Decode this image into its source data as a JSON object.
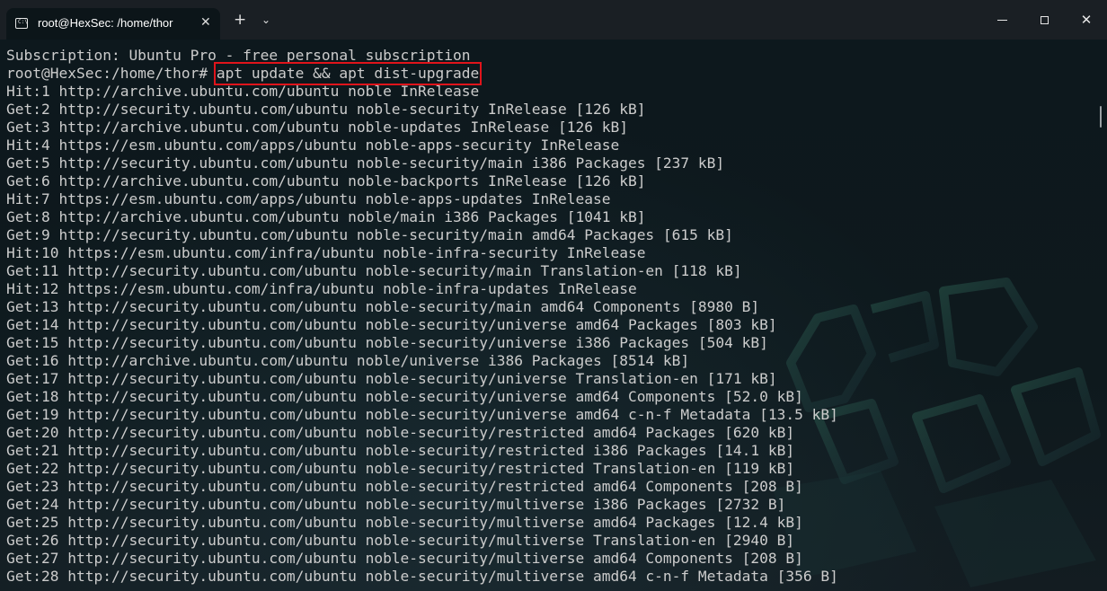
{
  "window": {
    "tab_title": "root@HexSec: /home/thor",
    "tab_icon": "terminal-icon",
    "tab_close": "✕",
    "new_tab": "+",
    "tab_dropdown": "⌄",
    "close_glyph": "✕"
  },
  "terminal": {
    "colors": {
      "text": "#cccccc",
      "highlight_box": "#e0141b",
      "background": "#0c1519"
    },
    "prompt": "root@HexSec:/home/thor# ",
    "command": "apt update && apt dist-upgrade",
    "lines": [
      "Subscription: Ubuntu Pro - free personal subscription",
      "Hit:1 http://archive.ubuntu.com/ubuntu noble InRelease",
      "Get:2 http://security.ubuntu.com/ubuntu noble-security InRelease [126 kB]",
      "Get:3 http://archive.ubuntu.com/ubuntu noble-updates InRelease [126 kB]",
      "Hit:4 https://esm.ubuntu.com/apps/ubuntu noble-apps-security InRelease",
      "Get:5 http://security.ubuntu.com/ubuntu noble-security/main i386 Packages [237 kB]",
      "Get:6 http://archive.ubuntu.com/ubuntu noble-backports InRelease [126 kB]",
      "Hit:7 https://esm.ubuntu.com/apps/ubuntu noble-apps-updates InRelease",
      "Get:8 http://archive.ubuntu.com/ubuntu noble/main i386 Packages [1041 kB]",
      "Get:9 http://security.ubuntu.com/ubuntu noble-security/main amd64 Packages [615 kB]",
      "Hit:10 https://esm.ubuntu.com/infra/ubuntu noble-infra-security InRelease",
      "Get:11 http://security.ubuntu.com/ubuntu noble-security/main Translation-en [118 kB]",
      "Hit:12 https://esm.ubuntu.com/infra/ubuntu noble-infra-updates InRelease",
      "Get:13 http://security.ubuntu.com/ubuntu noble-security/main amd64 Components [8980 B]",
      "Get:14 http://security.ubuntu.com/ubuntu noble-security/universe amd64 Packages [803 kB]",
      "Get:15 http://security.ubuntu.com/ubuntu noble-security/universe i386 Packages [504 kB]",
      "Get:16 http://archive.ubuntu.com/ubuntu noble/universe i386 Packages [8514 kB]",
      "Get:17 http://security.ubuntu.com/ubuntu noble-security/universe Translation-en [171 kB]",
      "Get:18 http://security.ubuntu.com/ubuntu noble-security/universe amd64 Components [52.0 kB]",
      "Get:19 http://security.ubuntu.com/ubuntu noble-security/universe amd64 c-n-f Metadata [13.5 kB]",
      "Get:20 http://security.ubuntu.com/ubuntu noble-security/restricted amd64 Packages [620 kB]",
      "Get:21 http://security.ubuntu.com/ubuntu noble-security/restricted i386 Packages [14.1 kB]",
      "Get:22 http://security.ubuntu.com/ubuntu noble-security/restricted Translation-en [119 kB]",
      "Get:23 http://security.ubuntu.com/ubuntu noble-security/restricted amd64 Components [208 B]",
      "Get:24 http://security.ubuntu.com/ubuntu noble-security/multiverse i386 Packages [2732 B]",
      "Get:25 http://security.ubuntu.com/ubuntu noble-security/multiverse amd64 Packages [12.4 kB]",
      "Get:26 http://security.ubuntu.com/ubuntu noble-security/multiverse Translation-en [2940 B]",
      "Get:27 http://security.ubuntu.com/ubuntu noble-security/multiverse amd64 Components [208 B]",
      "Get:28 http://security.ubuntu.com/ubuntu noble-security/multiverse amd64 c-n-f Metadata [356 B]"
    ]
  }
}
